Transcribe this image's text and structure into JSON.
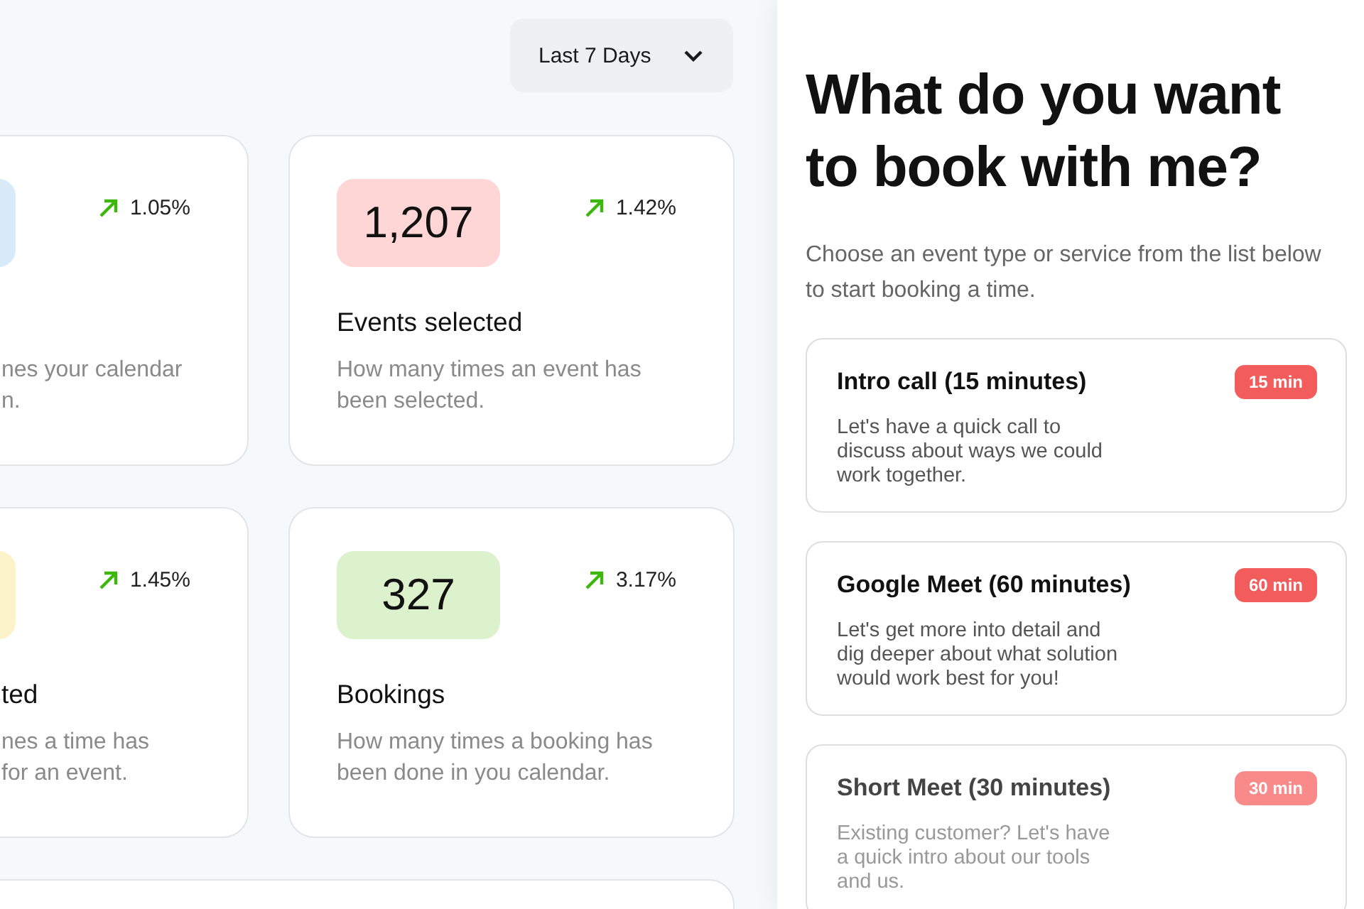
{
  "range_select": {
    "value": "Last 7 Days"
  },
  "stats": [
    {
      "color": "#d8eaf8",
      "trend": "1.05%",
      "description": "nes your calendar\nn.",
      "cut": true
    },
    {
      "value": "1,207",
      "color": "#ffd6d6",
      "trend": "1.42%",
      "title": "Events selected",
      "description": "How many times an event has been selected.",
      "cut": false
    },
    {
      "color": "#fdf3c9",
      "trend": "1.45%",
      "title": "ted",
      "description": "nes a time has\n for an event.",
      "cut": true
    },
    {
      "value": "327",
      "color": "#dcf2cc",
      "trend": "3.17%",
      "title": "Bookings",
      "description": "How many times a booking has been done in you calendar.",
      "cut": false
    }
  ],
  "booking": {
    "heading": "What do you want to book with me?",
    "subtitle": "Choose an event type or service from the list below to start booking a time.",
    "events": [
      {
        "title": "Intro call (15 minutes)",
        "badge": "15 min",
        "description": "Let's have a quick call to discuss about ways we could work together.",
        "faded": false
      },
      {
        "title": "Google Meet (60 minutes)",
        "badge": "60 min",
        "description": "Let's get more into detail and dig deeper about what solution would work best for you!",
        "faded": false
      },
      {
        "title": "Short Meet (30 minutes)",
        "badge": "30 min",
        "description": "Existing customer? Let's have a quick intro about our tools and us.",
        "faded": true
      }
    ]
  }
}
